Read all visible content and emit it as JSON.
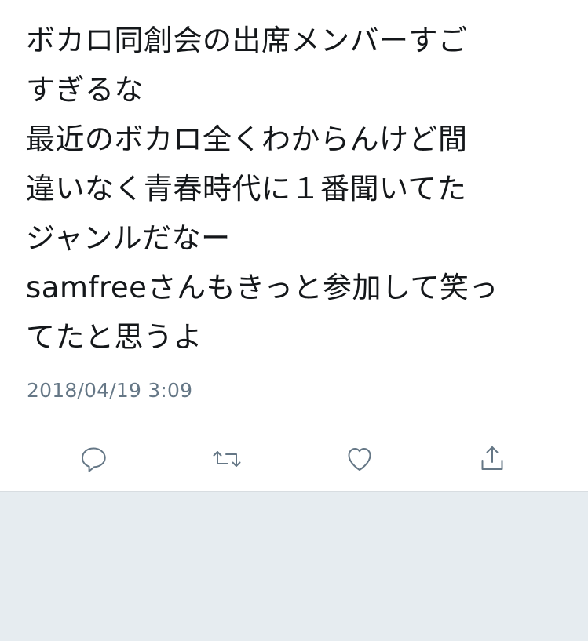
{
  "tweet": {
    "lines": [
      "ボカロ同創会の出席メンバーすご",
      "すぎるな",
      "最近のボカロ全くわからんけど間",
      "違いなく青春時代に１番聞いてた",
      "ジャンルだなー",
      "samfreeさんもきっと参加して笑っ",
      "てたと思うよ"
    ],
    "timestamp": "2018/04/19 3:09"
  },
  "actions": {
    "reply_icon": "reply-icon",
    "retweet_icon": "retweet-icon",
    "like_icon": "heart-icon",
    "share_icon": "share-icon"
  },
  "colors": {
    "text": "#14171a",
    "muted": "#657786",
    "divider": "#e1e8ed",
    "background": "#e6ecf0",
    "card": "#ffffff"
  }
}
